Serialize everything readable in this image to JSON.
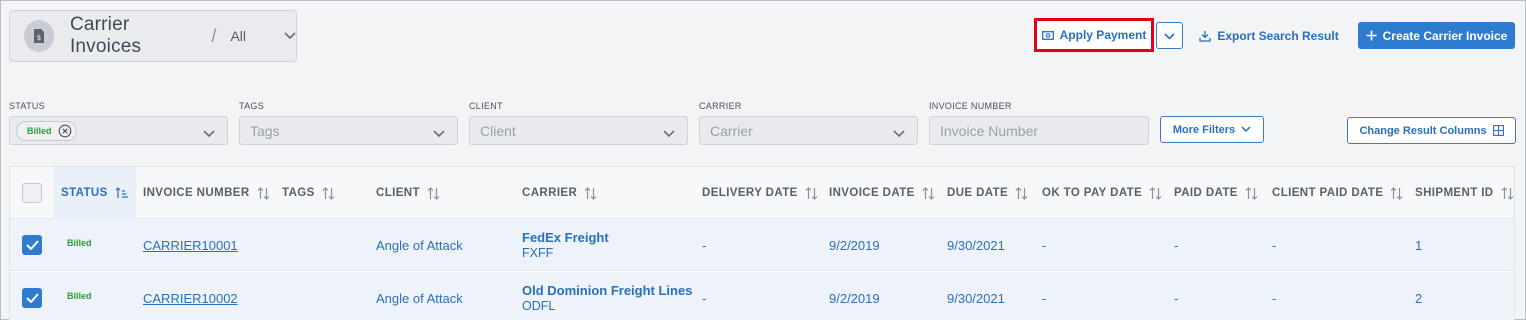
{
  "header": {
    "title": "Carrier Invoices",
    "separator": "/",
    "view": "All"
  },
  "toolbar": {
    "apply_payment": "Apply Payment",
    "export": "Export Search Result",
    "create": "Create Carrier Invoice"
  },
  "filters": {
    "status": {
      "label": "STATUS",
      "chip": "Billed"
    },
    "tags": {
      "label": "TAGS",
      "placeholder": "Tags"
    },
    "client": {
      "label": "CLIENT",
      "placeholder": "Client"
    },
    "carrier": {
      "label": "CARRIER",
      "placeholder": "Carrier"
    },
    "invoice_number": {
      "label": "INVOICE NUMBER",
      "placeholder": "Invoice Number"
    },
    "more_filters": "More Filters",
    "change_columns": "Change Result Columns"
  },
  "table": {
    "columns": {
      "status": "STATUS",
      "invoice_number": "INVOICE NUMBER",
      "tags": "TAGS",
      "client": "CLIENT",
      "carrier": "CARRIER",
      "delivery_date": "DELIVERY DATE",
      "invoice_date": "INVOICE DATE",
      "due_date": "DUE DATE",
      "ok_to_pay_date": "OK TO PAY DATE",
      "paid_date": "PAID DATE",
      "client_paid_date": "CLIENT PAID DATE",
      "shipment_id": "SHIPMENT ID"
    },
    "rows": [
      {
        "status": "Billed",
        "invoice_number": "CARRIER10001",
        "client": "Angle of Attack",
        "carrier_name": "FedEx Freight",
        "carrier_code": "FXFF",
        "delivery_date": "-",
        "invoice_date": "9/2/2019",
        "due_date": "9/30/2021",
        "ok_to_pay_date": "-",
        "paid_date": "-",
        "client_paid_date": "-",
        "shipment_id": "1"
      },
      {
        "status": "Billed",
        "invoice_number": "CARRIER10002",
        "client": "Angle of Attack",
        "carrier_name": "Old Dominion Freight Lines",
        "carrier_code": "ODFL",
        "delivery_date": "-",
        "invoice_date": "9/2/2019",
        "due_date": "9/30/2021",
        "ok_to_pay_date": "-",
        "paid_date": "-",
        "client_paid_date": "-",
        "shipment_id": "2"
      }
    ]
  },
  "colors": {
    "accent": "#2f7bd0",
    "highlight_border": "#e0001b",
    "status_green": "#2f9a3c"
  },
  "icons": [
    "invoice-document-icon",
    "chevron-down-icon",
    "payment-icon",
    "download-icon",
    "plus-icon",
    "close-circle-icon",
    "columns-icon",
    "sort-icon",
    "checkmark-icon"
  ]
}
